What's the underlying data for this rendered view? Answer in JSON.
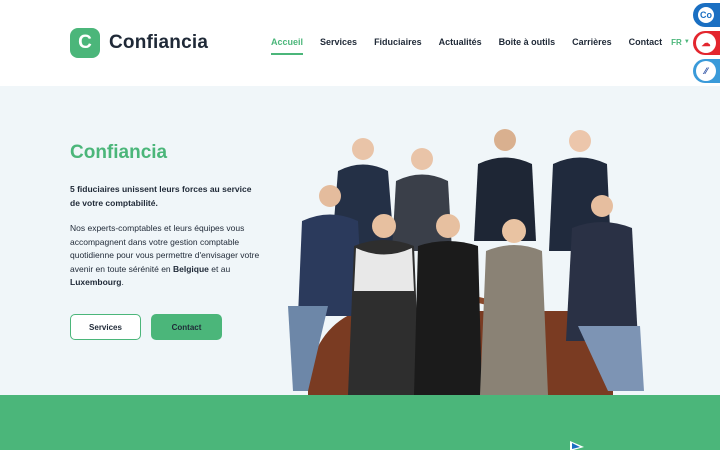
{
  "brand": {
    "mark": "C",
    "name": "Confiancia"
  },
  "nav": {
    "items": [
      {
        "label": "Accueil",
        "active": true
      },
      {
        "label": "Services",
        "active": false
      },
      {
        "label": "Fiduciaires",
        "active": false
      },
      {
        "label": "Actualités",
        "active": false
      },
      {
        "label": "Boite à outils",
        "active": false
      },
      {
        "label": "Carrières",
        "active": false
      },
      {
        "label": "Contact",
        "active": false
      }
    ],
    "language": "FR"
  },
  "side_icons": [
    {
      "name": "co-icon",
      "text": "Co"
    },
    {
      "name": "cloud-icon",
      "text": "☁"
    },
    {
      "name": "app-icon",
      "text": "⁄⁄"
    }
  ],
  "hero": {
    "title": "Confiancia",
    "lead": "5 fiduciaires unissent leurs forces au service de votre comptabilité.",
    "body_part1": "Nos experts-comptables et leurs équipes vous accompagnent dans votre gestion comptable quotidienne pour vous permettre d'envisager votre avenir en toute sérénité en ",
    "body_bold1": "Belgique",
    "body_part2": " et au ",
    "body_bold2": "Luxembourg",
    "body_part3": ".",
    "btn_services": "Services",
    "btn_contact": "Contact"
  },
  "colors": {
    "accent": "#4bb67a",
    "hero_bg": "#f0f6f9",
    "text": "#1f2937"
  }
}
